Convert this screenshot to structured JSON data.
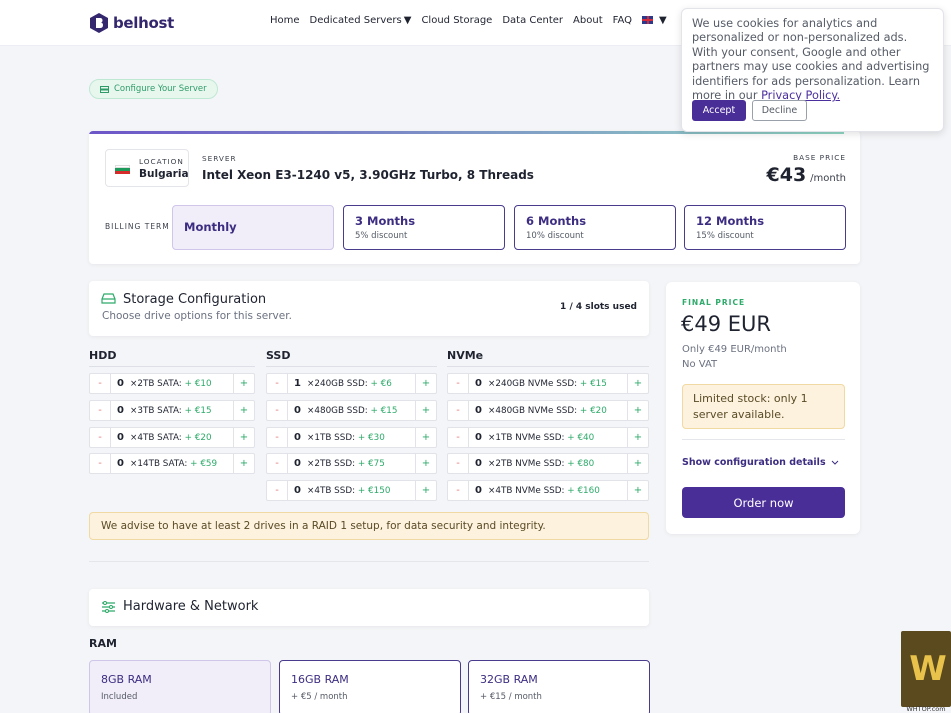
{
  "brand": {
    "name": "belhost"
  },
  "nav": {
    "items": [
      {
        "label": "Home"
      },
      {
        "label": "Dedicated Servers"
      },
      {
        "label": "Cloud Storage"
      },
      {
        "label": "Data Center"
      },
      {
        "label": "About"
      },
      {
        "label": "FAQ"
      }
    ]
  },
  "cookie": {
    "text": "We use cookies for analytics and personalized or non-personalized ads. With your consent, Google and other partners may use cookies and advertising identifiers for ads personalization. Learn more in our ",
    "link": "Privacy Policy.",
    "accept": "Accept",
    "decline": "Decline"
  },
  "configure_pill": "Configure Your Server",
  "server": {
    "location_label": "LOCATION",
    "location": "Bulgaria",
    "server_label": "SERVER",
    "name": "Intel Xeon E3-1240 v5, 3.90GHz Turbo, 8 Threads",
    "base_price_label": "BASE PRICE",
    "base_price": "€43",
    "base_price_unit": "/month"
  },
  "billing": {
    "label": "BILLING TERM",
    "terms": [
      {
        "name": "Monthly",
        "discount": ""
      },
      {
        "name": "3 Months",
        "discount": "5% discount"
      },
      {
        "name": "6 Months",
        "discount": "10% discount"
      },
      {
        "name": "12 Months",
        "discount": "15% discount"
      }
    ]
  },
  "storage": {
    "title": "Storage Configuration",
    "subtitle": "Choose drive options for this server.",
    "slots": "1 / 4 slots used",
    "minus": "-",
    "plus": "+",
    "hdd": {
      "title": "HDD",
      "drives": [
        {
          "qty": "0",
          "desc": "×2TB SATA: ",
          "price": "+ €10"
        },
        {
          "qty": "0",
          "desc": "×3TB SATA: ",
          "price": "+ €15"
        },
        {
          "qty": "0",
          "desc": "×4TB SATA: ",
          "price": "+ €20"
        },
        {
          "qty": "0",
          "desc": "×14TB SATA: ",
          "price": "+ €59"
        }
      ]
    },
    "ssd": {
      "title": "SSD",
      "drives": [
        {
          "qty": "1",
          "desc": "×240GB SSD: ",
          "price": "+ €6"
        },
        {
          "qty": "0",
          "desc": "×480GB SSD: ",
          "price": "+ €15"
        },
        {
          "qty": "0",
          "desc": "×1TB SSD: ",
          "price": "+ €30"
        },
        {
          "qty": "0",
          "desc": "×2TB SSD: ",
          "price": "+ €75"
        },
        {
          "qty": "0",
          "desc": "×4TB SSD: ",
          "price": "+ €150"
        }
      ]
    },
    "nvme": {
      "title": "NVMe",
      "drives": [
        {
          "qty": "0",
          "desc": "×240GB NVMe SSD: ",
          "price": "+ €15"
        },
        {
          "qty": "0",
          "desc": "×480GB NVMe SSD: ",
          "price": "+ €20"
        },
        {
          "qty": "0",
          "desc": "×1TB NVMe SSD: ",
          "price": "+ €40"
        },
        {
          "qty": "0",
          "desc": "×2TB NVMe SSD: ",
          "price": "+ €80"
        },
        {
          "qty": "0",
          "desc": "×4TB NVMe SSD: ",
          "price": "+ €160"
        }
      ]
    },
    "advice": "We advise to have at least 2 drives in a RAID 1 setup, for data security and integrity."
  },
  "hardware": {
    "title": "Hardware & Network",
    "ram_label": "RAM",
    "ram_options": [
      {
        "name": "8GB RAM",
        "price": "Included"
      },
      {
        "name": "16GB RAM",
        "price": "+ €5 / month"
      },
      {
        "name": "32GB RAM",
        "price": "+ €15 / month"
      }
    ]
  },
  "final": {
    "label": "FINAL PRICE",
    "value": "€49 EUR",
    "only": "Only €49 EUR/month",
    "vat": "No VAT",
    "stock": "Limited stock: only 1 server available.",
    "show_details": "Show configuration details",
    "order": "Order now"
  },
  "watermark": {
    "letters": "W",
    "sub": "WHTOP.com"
  },
  "colors": {
    "brand": "#35276e",
    "accent": "#4a2e98",
    "green": "#2eaa6a",
    "warning_bg": "#fcf2dd"
  }
}
